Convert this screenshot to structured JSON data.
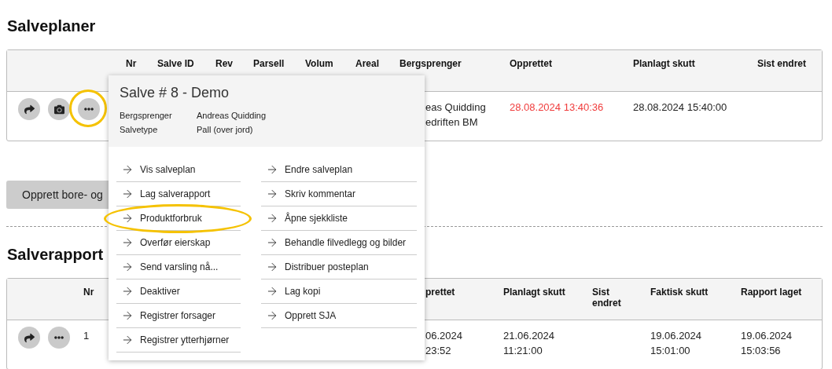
{
  "plans": {
    "title": "Salveplaner",
    "columns": [
      "Nr",
      "Salve ID",
      "Rev",
      "Parsell",
      "Volum",
      "Areal",
      "Bergsprenger",
      "Opprettet",
      "Planlagt skutt",
      "Sist endret"
    ],
    "rows": [
      {
        "actions": [
          {
            "kind": "share",
            "highlighted": false
          },
          {
            "kind": "camera",
            "highlighted": false
          },
          {
            "kind": "more",
            "highlighted": true
          }
        ],
        "bergsprenger": [
          "eas Quidding",
          "edriften BM"
        ],
        "opprettet": "28.08.2024 13:40:36",
        "opprettet_overdue": true,
        "planlagt": "28.08.2024 15:40:00"
      }
    ]
  },
  "create_button": "Opprett bore- og",
  "reports": {
    "title": "Salverapport",
    "columns": [
      "Nr",
      "prettet",
      "Planlagt skutt",
      "Sist endret",
      "Faktisk skutt",
      "Rapport laget"
    ],
    "rows": [
      {
        "actions": [
          {
            "kind": "share",
            "highlighted": false
          },
          {
            "kind": "more",
            "highlighted": false
          }
        ],
        "nr": "1",
        "opprettet": [
          "06.2024",
          "23:52"
        ],
        "planlagt": [
          "21.06.2024",
          "11:21:00"
        ],
        "faktisk": [
          "19.06.2024",
          "15:01:00"
        ],
        "rapport": [
          "19.06.2024",
          "15:03:56"
        ]
      }
    ]
  },
  "popup": {
    "title": "Salve # 8 - Demo",
    "info": [
      {
        "label": "Bergsprenger",
        "value": "Andreas Quidding"
      },
      {
        "label": "Salvetype",
        "value": "Pall (over jord)"
      }
    ],
    "left": [
      {
        "label": "Vis salveplan",
        "highlighted": false
      },
      {
        "label": "Lag salverapport",
        "highlighted": false
      },
      {
        "label": "Produktforbruk",
        "highlighted": true
      },
      {
        "label": "Overfør eierskap",
        "highlighted": false
      },
      {
        "label": "Send varsling nå...",
        "highlighted": false
      },
      {
        "label": "Deaktiver",
        "highlighted": false
      },
      {
        "label": "Registrer forsager",
        "highlighted": false
      },
      {
        "label": "Registrer ytterhjørner",
        "highlighted": false
      }
    ],
    "right": [
      {
        "label": "Endre salveplan",
        "highlighted": false
      },
      {
        "label": "Skriv kommentar",
        "highlighted": false
      },
      {
        "label": "Åpne sjekkliste",
        "highlighted": false
      },
      {
        "label": "Behandle filvedlegg og bilder",
        "highlighted": false
      },
      {
        "label": "Distribuer posteplan",
        "highlighted": false
      },
      {
        "label": "Lag kopi",
        "highlighted": false
      },
      {
        "label": "Opprett SJA",
        "highlighted": false
      }
    ]
  }
}
